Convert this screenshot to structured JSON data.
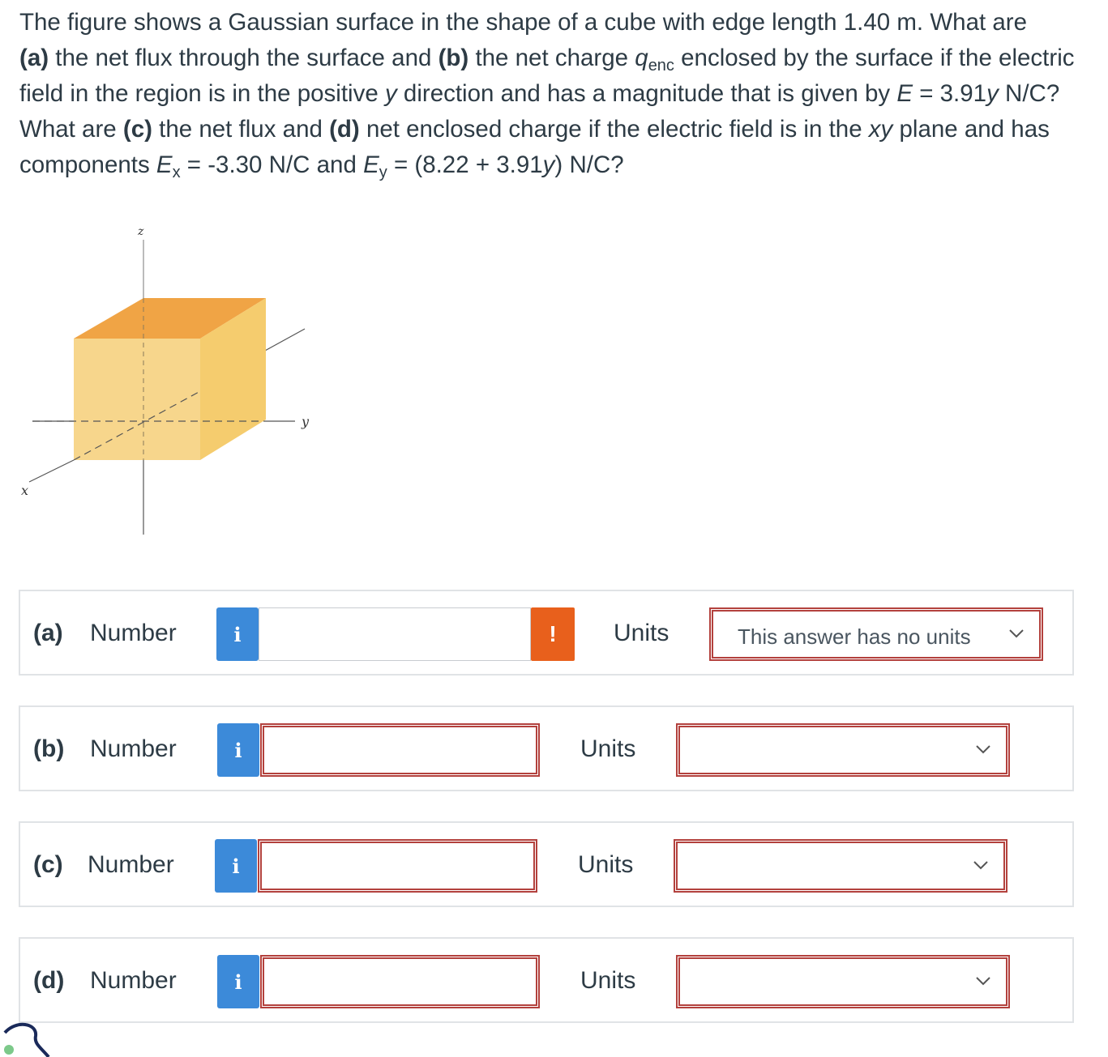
{
  "question": {
    "t1": "The figure shows a Gaussian surface in the shape of a cube with edge length 1.40 m. What are",
    "a_lbl": "(a)",
    "t2": " the net flux through the surface and ",
    "b_lbl": "(b)",
    "t3": " the net charge ",
    "q": "q",
    "q_sub": "enc",
    "t4": " enclosed by the surface if the electric field in the region is in the positive ",
    "y1": "y",
    "t5": " direction and has a magnitude that is given by ",
    "E": "E",
    "t6": " = 3.91",
    "y2": "y",
    "t7": " N/C? What are ",
    "c_lbl": "(c)",
    "t8": " the net flux and ",
    "d_lbl": "(d)",
    "t9": " net enclosed charge if the electric field is in the ",
    "xy": "xy",
    "t10": " plane and has components ",
    "Ex": "E",
    "Ex_sub": "x",
    "t11": " = -3.30 N/C and ",
    "Ey": "E",
    "Ey_sub": "y",
    "t12": " = (8.22 + 3.91",
    "y3": "y",
    "t13": ") N/C?"
  },
  "figure": {
    "axis_z": "z",
    "axis_y": "y",
    "axis_x": "x",
    "cube_top_color": "#f0a445",
    "cube_front_color": "#f7d68c",
    "cube_side_color": "#f5cc6e"
  },
  "answers": [
    {
      "part": "(a)",
      "number_label": "Number",
      "info": "i",
      "value": "",
      "warn": "!",
      "units_label": "Units",
      "units_value": "This answer has no units"
    },
    {
      "part": "(b)",
      "number_label": "Number",
      "info": "i",
      "value": "",
      "units_label": "Units",
      "units_value": ""
    },
    {
      "part": "(c)",
      "number_label": "Number",
      "info": "i",
      "value": "",
      "units_label": "Units",
      "units_value": ""
    },
    {
      "part": "(d)",
      "number_label": "Number",
      "info": "i",
      "value": "",
      "units_label": "Units",
      "units_value": ""
    }
  ],
  "colors": {
    "info_blue": "#3c8ad9",
    "warn_orange": "#e8601c",
    "error_border": "#b3413d"
  }
}
